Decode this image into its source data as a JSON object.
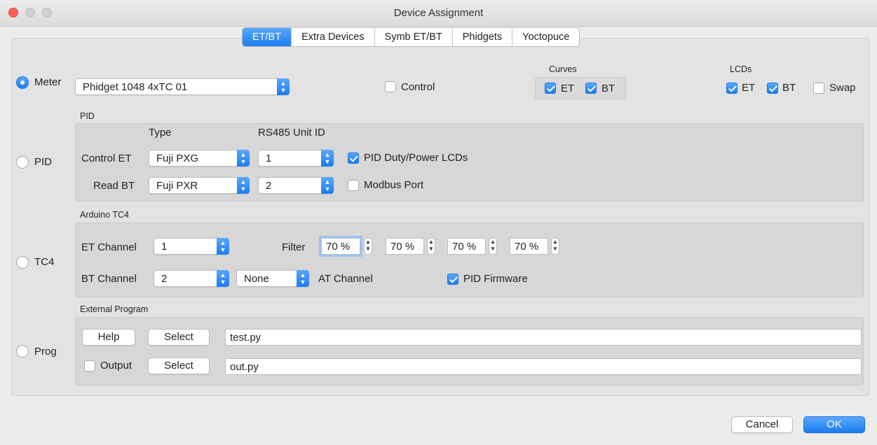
{
  "window": {
    "title": "Device Assignment"
  },
  "tabs": [
    {
      "label": "ET/BT",
      "active": true
    },
    {
      "label": "Extra Devices",
      "active": false
    },
    {
      "label": "Symb ET/BT",
      "active": false
    },
    {
      "label": "Phidgets",
      "active": false
    },
    {
      "label": "Yoctopuce",
      "active": false
    }
  ],
  "meter": {
    "radio_label": "Meter",
    "selected": true,
    "device": "Phidget 1048 4xTC 01",
    "control_label": "Control",
    "control_checked": false
  },
  "curves": {
    "title": "Curves",
    "et_label": "ET",
    "bt_label": "BT",
    "et_checked": true,
    "bt_checked": true
  },
  "lcds": {
    "title": "LCDs",
    "et_label": "ET",
    "bt_label": "BT",
    "swap_label": "Swap",
    "et_checked": true,
    "bt_checked": true,
    "swap_checked": false
  },
  "pid": {
    "radio_label": "PID",
    "section_title": "PID",
    "type_header": "Type",
    "unit_header": "RS485 Unit ID",
    "control_et_label": "Control ET",
    "control_et_type": "Fuji PXG",
    "control_et_unit": "1",
    "read_bt_label": "Read BT",
    "read_bt_type": "Fuji PXR",
    "read_bt_unit": "2",
    "duty_label": "PID Duty/Power LCDs",
    "duty_checked": true,
    "modbus_label": "Modbus Port",
    "modbus_checked": false
  },
  "tc4": {
    "radio_label": "TC4",
    "section_title": "Arduino TC4",
    "et_channel_label": "ET Channel",
    "et_channel": "1",
    "bt_channel_label": "BT Channel",
    "bt_channel": "2",
    "at_channel": "None",
    "at_channel_label": "AT Channel",
    "filter_label": "Filter",
    "filters": [
      "70 %",
      "70 %",
      "70 %",
      "70 %"
    ],
    "firmware_label": "PID Firmware",
    "firmware_checked": true
  },
  "prog": {
    "radio_label": "Prog",
    "section_title": "External Program",
    "help_label": "Help",
    "select_label": "Select",
    "program": "test.py",
    "output_label": "Output",
    "output_checked": false,
    "output_program": "out.py"
  },
  "footer": {
    "cancel_label": "Cancel",
    "ok_label": "OK"
  },
  "colors": {
    "accent": "#1b7cf0",
    "close": "#fc5f57",
    "panel": "#e3e3e3"
  }
}
